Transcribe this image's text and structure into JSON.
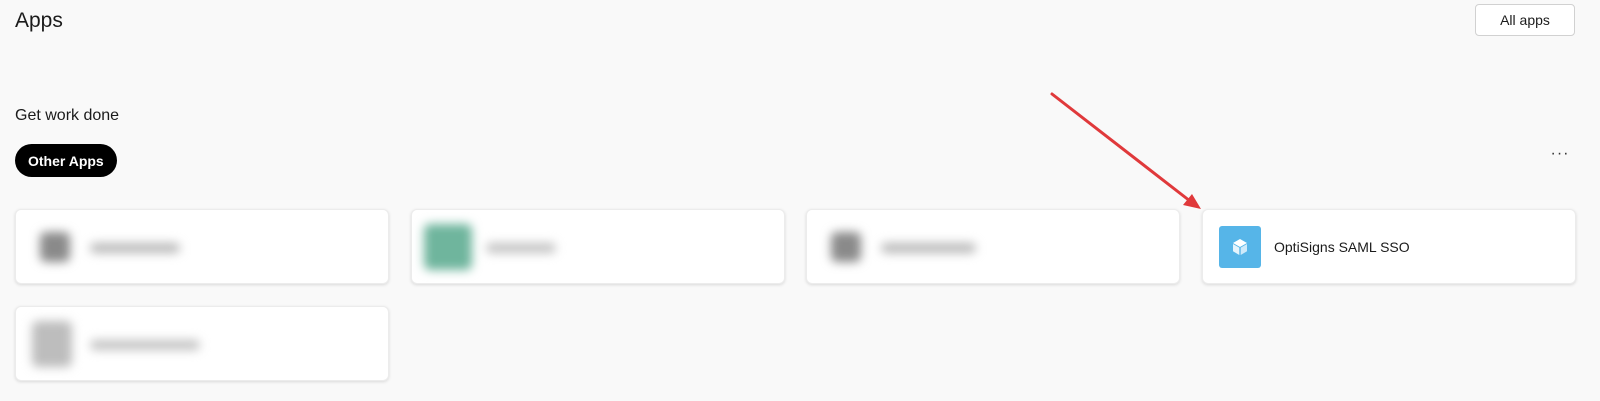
{
  "header": {
    "title": "Apps",
    "all_apps_label": "All apps"
  },
  "section": {
    "title": "Get work done",
    "filter_pill": "Other Apps",
    "more_label": "···"
  },
  "apps": [
    {
      "name": "OptiSigns SAML SSO",
      "icon": "cube-icon",
      "icon_color": "#56b5e8"
    }
  ],
  "colors": {
    "annotation_arrow": "#e0393b",
    "pill_background": "#000000",
    "page_background": "#f9f9f9"
  }
}
